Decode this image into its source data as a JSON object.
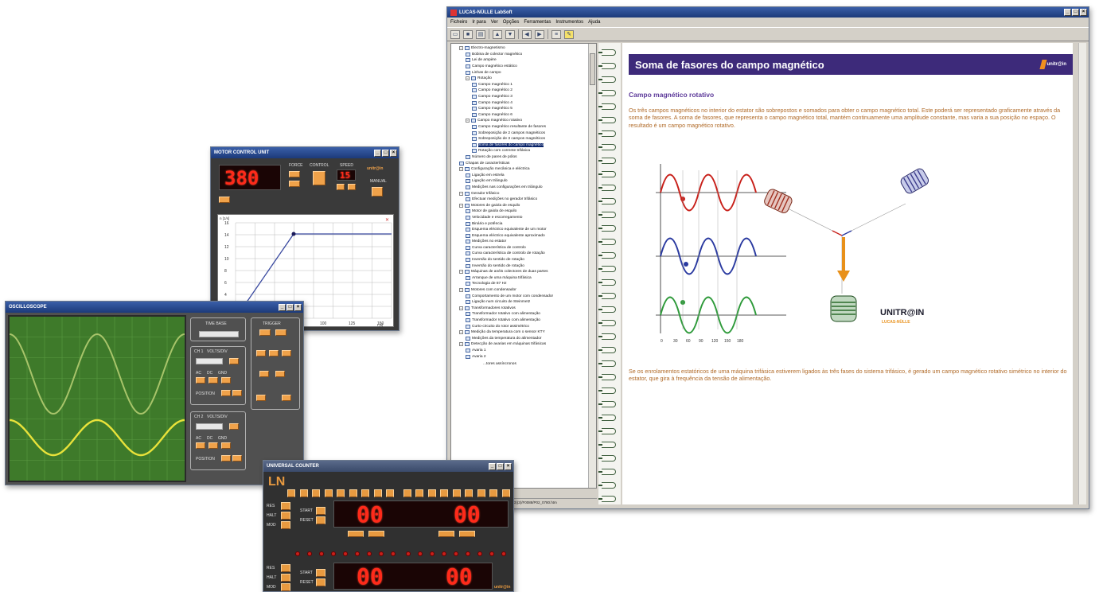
{
  "main_window": {
    "title": "LUCAS-NÜLLE LabSoft",
    "menu": [
      "Ficheiro",
      "Ir para",
      "Ver",
      "Opções",
      "Ferramentas",
      "Instrumentos",
      "Ajuda"
    ],
    "tree": [
      {
        "label": "Electro-magnetismo",
        "level": 1,
        "exp": true
      },
      {
        "label": "Bobina de colector magnético",
        "level": 2
      },
      {
        "label": "Lei de ampère",
        "level": 2
      },
      {
        "label": "Campo magnético estático",
        "level": 2
      },
      {
        "label": "Linhas de campo",
        "level": 2
      },
      {
        "label": "Rotação",
        "level": 2,
        "exp": true
      },
      {
        "label": "Campo magnético 1",
        "level": 3
      },
      {
        "label": "Campo magnético 2",
        "level": 3
      },
      {
        "label": "Campo magnético 3",
        "level": 3
      },
      {
        "label": "Campo magnético 4",
        "level": 3
      },
      {
        "label": "Campo magnético 5",
        "level": 3
      },
      {
        "label": "Campo magnético 6",
        "level": 3
      },
      {
        "label": "Campo magnético rotativo",
        "level": 2,
        "exp": true
      },
      {
        "label": "Campo magnético resultante de fasores",
        "level": 3
      },
      {
        "label": "Sobreposição de 2 campos magnéticos",
        "level": 3
      },
      {
        "label": "Sobreposição de 3 campos magnéticos",
        "level": 3
      },
      {
        "label": "Soma de fasores do campo magnético",
        "level": 3,
        "selected": true
      },
      {
        "label": "Rotação com corrente trifásica",
        "level": 3
      },
      {
        "label": "Número de pares de pólos",
        "level": 2
      },
      {
        "label": "Chapas de características",
        "level": 1
      },
      {
        "label": "Configuração mecânica e eléctrica",
        "level": 1,
        "exp": true
      },
      {
        "label": "Ligação em estrela",
        "level": 2
      },
      {
        "label": "Ligação em triângulo",
        "level": 2
      },
      {
        "label": "Medições nas configurações em triângulo",
        "level": 2
      },
      {
        "label": "Gerador trifásico",
        "level": 1,
        "exp": true
      },
      {
        "label": "Efectuar medições no gerador trifásico",
        "level": 2
      },
      {
        "label": "Motores de gaiola de esquilo",
        "level": 1,
        "exp": true
      },
      {
        "label": "Motor de gaiola de esquilo",
        "level": 2
      },
      {
        "label": "Velocidade e escorregamento",
        "level": 2
      },
      {
        "label": "Binário e potência",
        "level": 2
      },
      {
        "label": "Esquema eléctrico equivalente de um motor",
        "level": 2
      },
      {
        "label": "Esquema eléctrico equivalente aproximado",
        "level": 2
      },
      {
        "label": "Medições no estator",
        "level": 2
      },
      {
        "label": "Curva característica de controlo",
        "level": 2
      },
      {
        "label": "Curva característica de controlo de rotação",
        "level": 2
      },
      {
        "label": "Inversão do sentido de rotação",
        "level": 2
      },
      {
        "label": "Inversão do sentido de rotação",
        "level": 2
      },
      {
        "label": "Máquinas de anéis colectores de duas partes",
        "level": 1,
        "exp": true
      },
      {
        "label": "Arranque de uma máquina trifásica",
        "level": 2
      },
      {
        "label": "Tecnologia de 87 Hz",
        "level": 2
      },
      {
        "label": "Motores com condensador",
        "level": 1,
        "exp": true
      },
      {
        "label": "Comportamento de um motor com condensador",
        "level": 2
      },
      {
        "label": "Ligação num circuito de Steinmetz",
        "level": 2
      },
      {
        "label": "Transformadores rotativos",
        "level": 1,
        "exp": true
      },
      {
        "label": "Transformador rotativo com alimentação",
        "level": 2
      },
      {
        "label": "Transformador rotativo com alimentação",
        "level": 2
      },
      {
        "label": "Curto-circuito do rotor assimétrico",
        "level": 2
      },
      {
        "label": "Medição da temperatura com o sensor KTY",
        "level": 1,
        "exp": true
      },
      {
        "label": "Medições da temperatura do alimentador",
        "level": 2
      },
      {
        "label": "Detecção de avarias em máquinas trifásicas",
        "level": 1,
        "exp": true
      },
      {
        "label": "Avaria 1",
        "level": 2
      },
      {
        "label": "Avaria 2",
        "level": 2
      }
    ],
    "tree_tail": "...tores assíncronos",
    "status_path": "MPTCS2(3)(2)/F0088/P02_0780.htm",
    "page": {
      "header": "Soma de fasores do campo magnético",
      "logo": "unitr@in",
      "subtitle": "Campo magnético rotativo",
      "paragraph1": "Os três campos magnéticos no interior do estator são sobrepostos e somados para obter o campo magnético total. Este poderá ser representado graficamente através da soma de fasores. A soma de fasores, que representa o campo magnético total, mantém continuamente uma amplitude constante, mas varia a sua posição no espaço. O resultado é um campo magnético rotativo.",
      "paragraph2": "Se os enrolamentos estatóricos de uma máquina trifásica estiverem ligados às três fases do sistema trifásico, é gerado um campo magnético rotativo simétrico no interior do estator, que gira à frequência da tensão de alimentação.",
      "diagram_brand": "UNITR@IN",
      "diagram_brand_sub": "LUCAS-NÜLLE",
      "axis_ticks": [
        "0",
        "30",
        "60",
        "90",
        "120",
        "150",
        "180"
      ]
    }
  },
  "motor_window": {
    "title": "MOTOR CONTROL UNIT",
    "display": "380",
    "labels": [
      "FORCE",
      "CONTROL",
      "SPEED",
      "MANUAL"
    ],
    "small_display": "15",
    "logo": "unitr@in",
    "chart": {
      "y_ticks": [
        "16",
        "14",
        "12",
        "10",
        "8",
        "6",
        "4",
        "2"
      ],
      "x_ticks": [
        "75",
        "100",
        "125",
        "150"
      ],
      "x_unit": "t [s]",
      "y_unit": "n [1/s]"
    }
  },
  "osc_window": {
    "title": "OSCILLOSCOPE",
    "labels": [
      "TIME BASE",
      "TRIGGER",
      "CH 1",
      "CH 2",
      "VOLTS/DIV",
      "AC",
      "DC",
      "GND",
      "POSITION"
    ]
  },
  "counter_window": {
    "title": "UNIVERSAL COUNTER",
    "logo_mark": "LN",
    "display_top": [
      "00",
      "00"
    ],
    "display_bottom": [
      "00",
      "00"
    ],
    "row_labels": [
      "RES",
      "HALT",
      "MOD",
      "START",
      "RESET"
    ],
    "brand": "unitr@in"
  },
  "colors": {
    "header_purple": "#3d2a7a",
    "text_orange": "#b06a28",
    "subtitle_purple": "#5d3a9a",
    "led_red": "#ff2a1a",
    "button_orange": "#f0a24a",
    "scope_green": "#3e7a2a",
    "trace_1": "#a8c46a",
    "trace_2": "#e8e23a"
  }
}
